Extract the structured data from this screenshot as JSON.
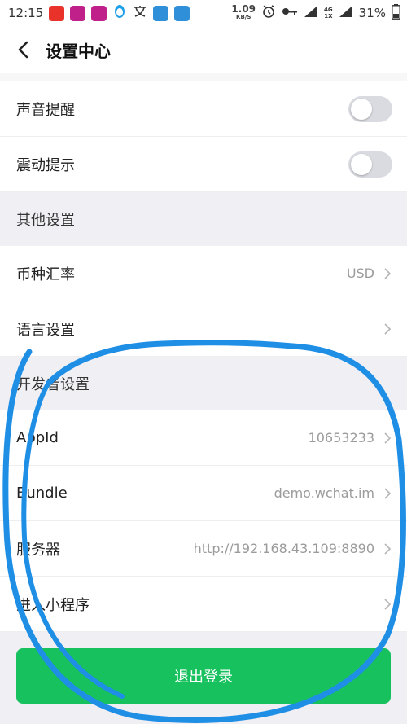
{
  "status_bar": {
    "time": "12:15",
    "net_speed_value": "1.09",
    "net_speed_unit": "KB/S",
    "net_type_top": "4G",
    "net_type_bottom": "1X",
    "battery": "31%",
    "icons": [
      "weibo-icon",
      "youku-icon",
      "youku-icon",
      "qq-icon",
      "translate-icon",
      "hotspot-icon",
      "hotspot-icon",
      "alarm-icon",
      "key-icon",
      "signal-icon",
      "battery-icon"
    ]
  },
  "nav": {
    "title": "设置中心"
  },
  "settings": {
    "sound_alert": {
      "label": "声音提醒",
      "enabled": false
    },
    "vibration": {
      "label": "震动提示",
      "enabled": false
    },
    "other_header": "其他设置",
    "currency": {
      "label": "币种汇率",
      "value": "USD"
    },
    "language": {
      "label": "语言设置"
    },
    "dev_header": "开发者设置",
    "appid": {
      "label": "AppId",
      "value": "10653233"
    },
    "bundle": {
      "label": "Bundle",
      "value": "demo.wchat.im"
    },
    "server": {
      "label": "服务器",
      "value": "http://192.168.43.109:8890"
    },
    "mini_program": {
      "label": "进入小程序"
    }
  },
  "logout": {
    "label": "退出登录"
  },
  "colors": {
    "accent_green": "#17c15e",
    "annotation_blue": "#1f8fe6",
    "toggle_off": "#d9dbe0"
  }
}
